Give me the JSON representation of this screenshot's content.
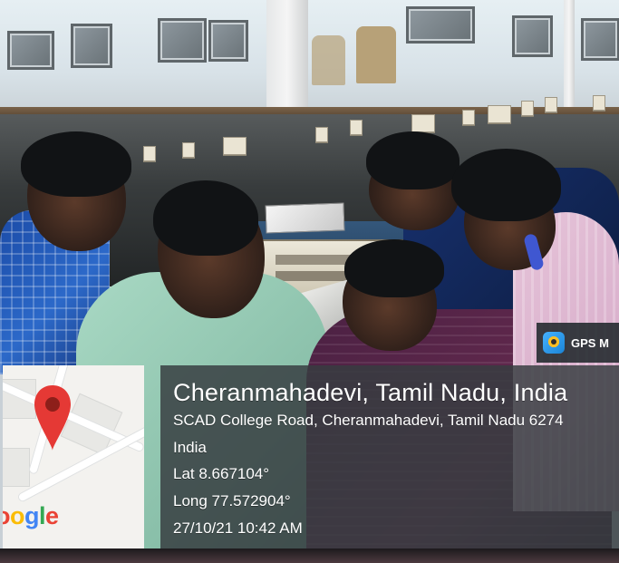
{
  "overlay": {
    "gps_badge_text": "GPS M",
    "location_title": "Cheranmahadevi, Tamil Nadu, India",
    "address": "SCAD College Road, Cheranmahadevi, Tamil Nadu 6274",
    "country": "India",
    "latitude": "Lat 8.667104°",
    "longitude": "Long 77.572904°",
    "timestamp": "27/10/21 10:42 AM"
  },
  "map": {
    "logo_text": "oogle"
  },
  "icons": {
    "camera": "camera-icon",
    "pin": "location-pin-icon"
  },
  "colors": {
    "map_pin_red": "#e53935",
    "google_blue": "#4285f4",
    "google_red": "#ea4335",
    "google_yellow": "#fbbc05",
    "google_green": "#34a853"
  }
}
